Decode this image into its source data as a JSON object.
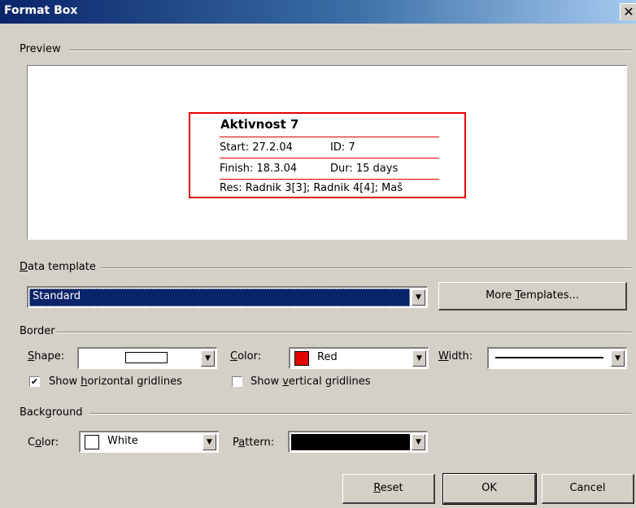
{
  "window": {
    "title": "Format Box",
    "close_glyph": "✕"
  },
  "preview": {
    "group_label": "Preview",
    "node": {
      "title": "Aktivnost 7",
      "row1_left": "Start:  27.2.04",
      "row1_right": "ID:   7",
      "row2_left": "Finish: 18.3.04",
      "row2_right": "Dur: 15 days",
      "row3": "Res:    Radnik 3[3]; Radnik 4[4]; Maš",
      "border_color": "#e00000"
    }
  },
  "data_template": {
    "group_label_pre": "",
    "group_label_u": "D",
    "group_label_post": "ata template",
    "selected": "Standard",
    "more_button_pre": "More ",
    "more_button_u": "T",
    "more_button_post": "emplates..."
  },
  "border": {
    "group_label": "Border",
    "shape_label_u": "S",
    "shape_label_post": "hape:",
    "color_label_u": "C",
    "color_label_post": "olor:",
    "color_value": "Red",
    "color_swatch": "#e00000",
    "width_label_u": "W",
    "width_label_post": "idth:",
    "hgrid_checked": true,
    "hgrid_pre": "Show ",
    "hgrid_u": "h",
    "hgrid_post": "orizontal gridlines",
    "vgrid_checked": false,
    "vgrid_pre": "Show ",
    "vgrid_u": "v",
    "vgrid_post": "ertical gridlines"
  },
  "background": {
    "group_label": "Background",
    "color_label_pre": "C",
    "color_label_u": "o",
    "color_label_post": "lor:",
    "color_value": "White",
    "color_swatch": "#ffffff",
    "pattern_label_pre": "P",
    "pattern_label_u": "a",
    "pattern_label_post": "ttern:",
    "pattern_fill": "#000000"
  },
  "buttons": {
    "reset_u": "R",
    "reset_post": "eset",
    "ok": "OK",
    "cancel": "Cancel"
  }
}
